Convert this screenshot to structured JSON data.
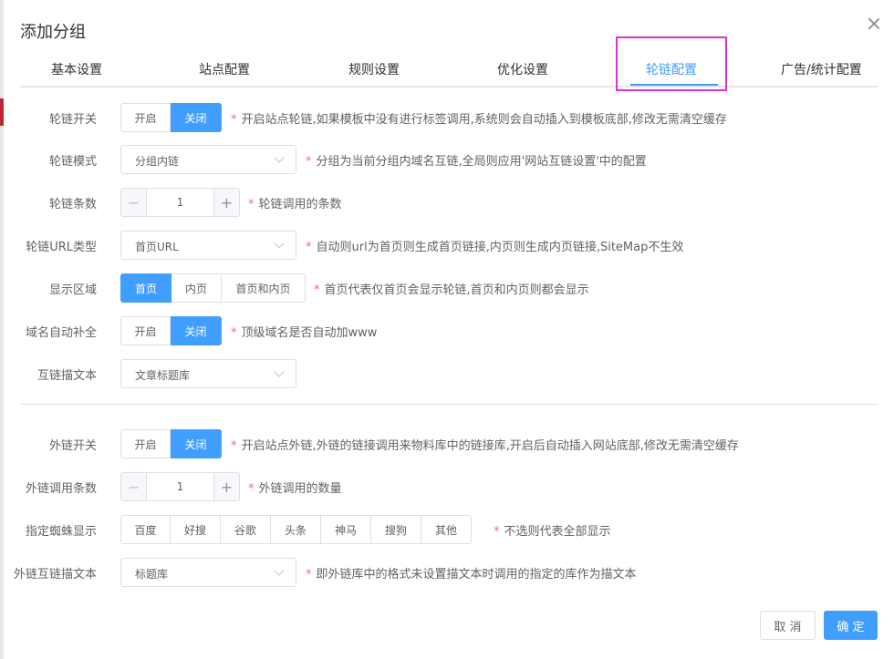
{
  "dialog": {
    "title": "添加分组"
  },
  "tabs": [
    {
      "label": "基本设置",
      "active": false
    },
    {
      "label": "站点配置",
      "active": false
    },
    {
      "label": "规则设置",
      "active": false
    },
    {
      "label": "优化设置",
      "active": false
    },
    {
      "label": "轮链配置",
      "active": true
    },
    {
      "label": "广告/统计配置",
      "active": false
    }
  ],
  "annotation": {
    "highlight_color": "#e02fd7"
  },
  "colors": {
    "accent": "#409eff",
    "required": "#f56c6c"
  },
  "form": {
    "lunlian_switch": {
      "label": "轮链开关",
      "options": [
        "开启",
        "关闭"
      ],
      "selected": "关闭",
      "tip": "开启站点轮链,如果模板中没有进行标签调用,系统则会自动插入到模板底部,修改无需清空缓存"
    },
    "lunlian_mode": {
      "label": "轮链模式",
      "value": "分组内链",
      "tip": "分组为当前分组内域名互链,全局则应用'网站互链设置'中的配置"
    },
    "lunlian_count": {
      "label": "轮链条数",
      "value": "1",
      "minus": "−",
      "plus": "+",
      "tip": "轮链调用的条数"
    },
    "lunlian_url_type": {
      "label": "轮链URL类型",
      "value": "首页URL",
      "tip": "自动则url为首页则生成首页链接,内页则生成内页链接,SiteMap不生效"
    },
    "display_area": {
      "label": "显示区域",
      "options": [
        "首页",
        "内页",
        "首页和内页"
      ],
      "selected": "首页",
      "tip": "首页代表仅首页会显示轮链,首页和内页则都会显示"
    },
    "domain_autocomplete": {
      "label": "域名自动补全",
      "options": [
        "开启",
        "关闭"
      ],
      "selected": "关闭",
      "tip": "顶级域名是否自动加www"
    },
    "link_anchor_text": {
      "label": "互链描文本",
      "value": "文章标题库"
    },
    "outlink_switch": {
      "label": "外链开关",
      "options": [
        "开启",
        "关闭"
      ],
      "selected": "关闭",
      "tip": "开启站点外链,外链的链接调用来物料库中的链接库,开启后自动插入网站底部,修改无需清空缓存"
    },
    "outlink_count": {
      "label": "外链调用条数",
      "value": "1",
      "minus": "−",
      "plus": "+",
      "tip": "外链调用的数量"
    },
    "spider_display": {
      "label": "指定蜘蛛显示",
      "options": [
        "百度",
        "好搜",
        "谷歌",
        "头条",
        "神马",
        "搜狗",
        "其他"
      ],
      "tip": "不选则代表全部显示"
    },
    "outlink_anchor_text": {
      "label": "外链互链描文本",
      "value": "标题库",
      "tip": "即外链库中的格式未设置描文本时调用的指定的库作为描文本"
    }
  },
  "footer": {
    "cancel": "取 消",
    "ok": "确 定"
  },
  "required_mark": "*"
}
